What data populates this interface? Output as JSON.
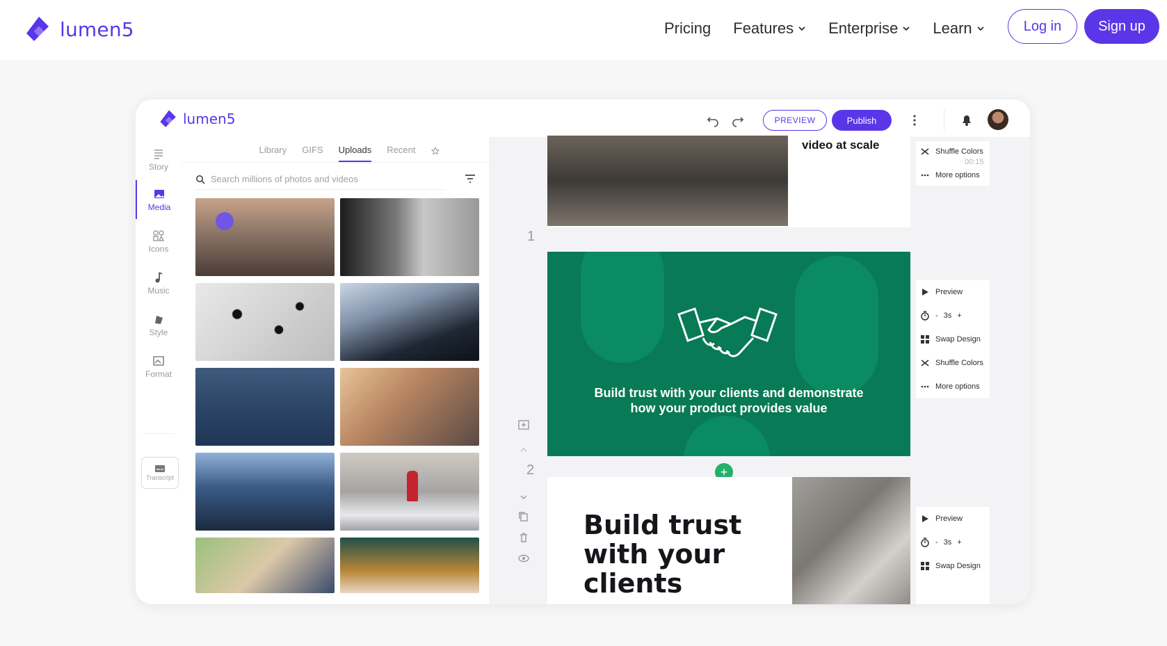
{
  "site": {
    "brand": "lumen5",
    "nav": [
      {
        "label": "Pricing",
        "dropdown": false
      },
      {
        "label": "Features",
        "dropdown": true
      },
      {
        "label": "Enterprise",
        "dropdown": true
      },
      {
        "label": "Learn",
        "dropdown": true
      }
    ],
    "login_label": "Log in",
    "signup_label": "Sign up",
    "accent": "#5b36e8"
  },
  "app": {
    "brand": "lumen5",
    "preview_label": "PREVIEW",
    "publish_label": "Publish",
    "rail": [
      {
        "label": "Story",
        "icon": "story-icon"
      },
      {
        "label": "Media",
        "icon": "image-icon",
        "active": true
      },
      {
        "label": "Icons",
        "icon": "shapes-icon"
      },
      {
        "label": "Music",
        "icon": "music-note-icon"
      },
      {
        "label": "Style",
        "icon": "style-icon"
      },
      {
        "label": "Format",
        "icon": "format-icon"
      }
    ],
    "transcript_label": "Transcript",
    "media": {
      "tabs": [
        "Library",
        "GIFS",
        "Uploads",
        "Recent"
      ],
      "active_tab": "Uploads",
      "search_placeholder": "Search millions of photos and videos"
    },
    "canvas": {
      "scene0_text": "video at scale",
      "scene1_number": "1",
      "scene1_caption_line1": "Build trust with your clients and demonstrate",
      "scene1_caption_line2": "how your product provides value",
      "scene2_number": "2",
      "scene2_title_line1": "Build trust",
      "scene2_title_line2": "with your",
      "scene2_title_line3": "clients",
      "scene_green": "#087a55"
    },
    "options": {
      "top": {
        "shuffle": "Shuffle Colors",
        "time": "00:15",
        "more": "More options"
      },
      "mid": {
        "preview": "Preview",
        "minus": "-",
        "duration": "3s",
        "plus": "+",
        "swap": "Swap Design",
        "shuffle": "Shuffle Colors",
        "more": "More options"
      },
      "bottom": {
        "preview": "Preview",
        "minus": "-",
        "duration": "3s",
        "plus": "+",
        "swap": "Swap Design"
      }
    }
  }
}
